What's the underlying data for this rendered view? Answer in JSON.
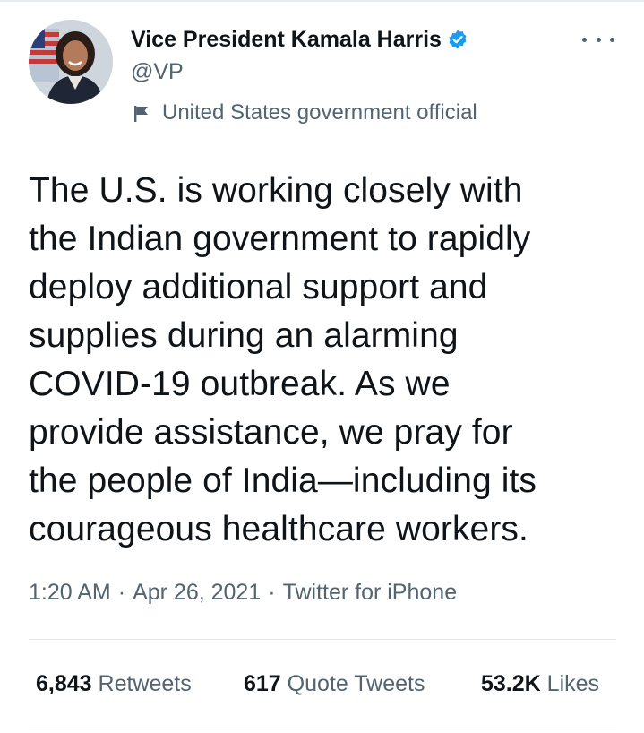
{
  "tweet": {
    "author": {
      "display_name": "Vice President Kamala Harris",
      "handle": "@VP",
      "verified_icon": "verified-badge-icon",
      "label": "United States government official",
      "label_icon": "flag-icon"
    },
    "text": "The U.S. is working closely with\nthe Indian government to rapidly\ndeploy additional support and\nsupplies during an alarming\nCOVID-19 outbreak. As we\nprovide assistance, we pray for\nthe people of India—including its\ncourageous healthcare workers.",
    "time": "1:20 AM",
    "date": "Apr 26, 2021",
    "source": "Twitter for iPhone",
    "separator": "·",
    "stats": {
      "retweets_count": "6,843",
      "retweets_label": "Retweets",
      "quotes_count": "617",
      "quotes_label": "Quote Tweets",
      "likes_count": "53.2K",
      "likes_label": "Likes"
    },
    "more_icon": "more-options-icon"
  },
  "colors": {
    "verified_blue": "#1d9bf0",
    "text_primary": "#0f1419",
    "text_secondary": "#536471"
  }
}
